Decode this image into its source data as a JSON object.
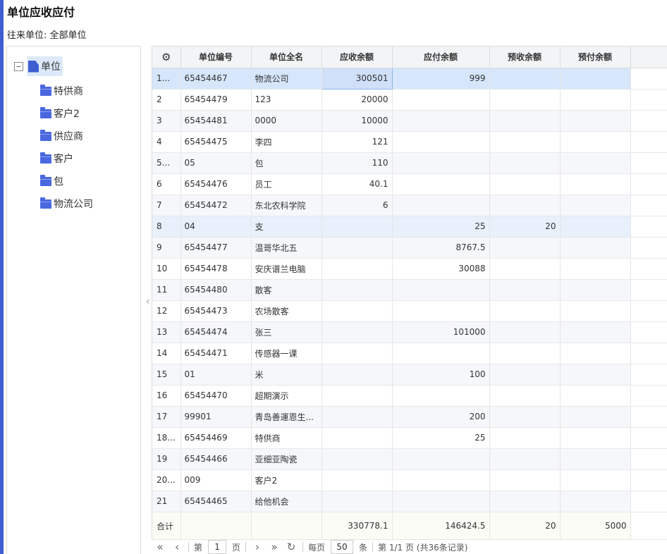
{
  "page": {
    "title": "单位应收应付",
    "unit_filter_label": "往来单位:",
    "unit_filter_value": "全部单位"
  },
  "tree": {
    "toggle": "−",
    "root_label": "单位",
    "children": [
      "特供商",
      "客户2",
      "供应商",
      "客户",
      "包",
      "物流公司"
    ]
  },
  "grid": {
    "columns": [
      "单位编号",
      "单位全名",
      "应收余额",
      "应付余额",
      "预收余额",
      "预付余额"
    ],
    "rows": [
      {
        "no": "1...",
        "code": "65454467",
        "name": "物流公司",
        "ar": "300501",
        "ap": "999",
        "pr": "",
        "pp": ""
      },
      {
        "no": "2",
        "code": "65454479",
        "name": "123",
        "ar": "20000",
        "ap": "",
        "pr": "",
        "pp": ""
      },
      {
        "no": "3",
        "code": "65454481",
        "name": "0000",
        "ar": "10000",
        "ap": "",
        "pr": "",
        "pp": ""
      },
      {
        "no": "4",
        "code": "65454475",
        "name": "李四",
        "ar": "121",
        "ap": "",
        "pr": "",
        "pp": ""
      },
      {
        "no": "5...",
        "code": "05",
        "name": "包",
        "ar": "110",
        "ap": "",
        "pr": "",
        "pp": ""
      },
      {
        "no": "6",
        "code": "65454476",
        "name": "员工",
        "ar": "40.1",
        "ap": "",
        "pr": "",
        "pp": ""
      },
      {
        "no": "7",
        "code": "65454472",
        "name": "东北农科学院",
        "ar": "6",
        "ap": "",
        "pr": "",
        "pp": ""
      },
      {
        "no": "8",
        "code": "04",
        "name": "支",
        "ar": "",
        "ap": "25",
        "pr": "20",
        "pp": ""
      },
      {
        "no": "9",
        "code": "65454477",
        "name": "温哥华北五",
        "ar": "",
        "ap": "8767.5",
        "pr": "",
        "pp": ""
      },
      {
        "no": "10",
        "code": "65454478",
        "name": "安庆谱兰电脑",
        "ar": "",
        "ap": "30088",
        "pr": "",
        "pp": ""
      },
      {
        "no": "11",
        "code": "65454480",
        "name": "散客",
        "ar": "",
        "ap": "",
        "pr": "",
        "pp": ""
      },
      {
        "no": "12",
        "code": "65454473",
        "name": "农场散客",
        "ar": "",
        "ap": "",
        "pr": "",
        "pp": ""
      },
      {
        "no": "13",
        "code": "65454474",
        "name": "张三",
        "ar": "",
        "ap": "101000",
        "pr": "",
        "pp": ""
      },
      {
        "no": "14",
        "code": "65454471",
        "name": "传感器一课",
        "ar": "",
        "ap": "",
        "pr": "",
        "pp": ""
      },
      {
        "no": "15",
        "code": "01",
        "name": "米",
        "ar": "",
        "ap": "100",
        "pr": "",
        "pp": ""
      },
      {
        "no": "16",
        "code": "65454470",
        "name": "超期演示",
        "ar": "",
        "ap": "",
        "pr": "",
        "pp": ""
      },
      {
        "no": "17",
        "code": "99901",
        "name": "青岛善運恩生...",
        "ar": "",
        "ap": "200",
        "pr": "",
        "pp": ""
      },
      {
        "no": "18...",
        "code": "65454469",
        "name": "特供商",
        "ar": "",
        "ap": "25",
        "pr": "",
        "pp": ""
      },
      {
        "no": "19",
        "code": "65454466",
        "name": "亚细亚陶瓷",
        "ar": "",
        "ap": "",
        "pr": "",
        "pp": ""
      },
      {
        "no": "20...",
        "code": "009",
        "name": "客户2",
        "ar": "",
        "ap": "",
        "pr": "",
        "pp": ""
      },
      {
        "no": "21",
        "code": "65454465",
        "name": "给他机会",
        "ar": "",
        "ap": "",
        "pr": "",
        "pp": ""
      }
    ],
    "total": {
      "label": "合计",
      "ar": "330778.1",
      "ap": "146424.5",
      "pr": "20",
      "pp": "5000"
    }
  },
  "pager": {
    "page_prefix": "第",
    "page_value": "1",
    "page_suffix": "页",
    "per_page_label": "每页",
    "per_page_value": "50",
    "per_page_unit": "条",
    "summary": "第 1/1 页 (共36条记录)"
  },
  "colors": {
    "accent": "#3f5ed1",
    "selected_row": "#d6e6fb",
    "folder": "#4a68e0"
  }
}
